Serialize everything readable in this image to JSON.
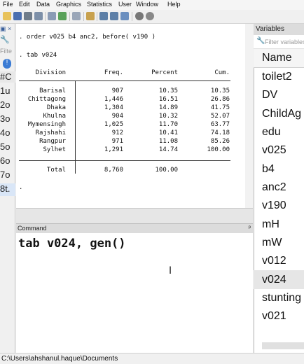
{
  "menu": [
    "File",
    "Edit",
    "Data",
    "Graphics",
    "Statistics",
    "User",
    "Window",
    "Help"
  ],
  "left_panel": {
    "filter_placeholder": "Filte",
    "col_label": "#C",
    "items": [
      "1u",
      "2o",
      "3o",
      "4o",
      "5o",
      "6o",
      "7o",
      "8t."
    ]
  },
  "results": {
    "cmd1": ". order v025 b4 anc2, before( v190 )",
    "cmd2": ". tab v024",
    "headers": {
      "division": "Division",
      "freq": "Freq.",
      "percent": "Percent",
      "cum": "Cum."
    },
    "rows": [
      {
        "division": "Barisal",
        "freq": "907",
        "percent": "10.35",
        "cum": "10.35"
      },
      {
        "division": "Chittagong",
        "freq": "1,446",
        "percent": "16.51",
        "cum": "26.86"
      },
      {
        "division": "Dhaka",
        "freq": "1,304",
        "percent": "14.89",
        "cum": "41.75"
      },
      {
        "division": "Khulna",
        "freq": "904",
        "percent": "10.32",
        "cum": "52.07"
      },
      {
        "division": "Mymensingh",
        "freq": "1,025",
        "percent": "11.70",
        "cum": "63.77"
      },
      {
        "division": "Rajshahi",
        "freq": "912",
        "percent": "10.41",
        "cum": "74.18"
      },
      {
        "division": "Rangpur",
        "freq": "971",
        "percent": "11.08",
        "cum": "85.26"
      },
      {
        "division": "Sylhet",
        "freq": "1,291",
        "percent": "14.74",
        "cum": "100.00"
      }
    ],
    "total": {
      "label": "Total",
      "freq": "8,760",
      "percent": "100.00"
    },
    "prompt": "."
  },
  "command": {
    "title": "Command",
    "text": "tab v024, gen()"
  },
  "variables": {
    "title": "Variables",
    "filter_placeholder": "Filter variables",
    "col_name": "Name",
    "items": [
      "toilet2",
      "DV",
      "ChildAg",
      "edu",
      "v025",
      "b4",
      "anc2",
      "v190",
      "mH",
      "mW",
      "v012",
      "v024",
      "stunting",
      "v021"
    ],
    "selected_index": 11
  },
  "status_bar": {
    "path": "C:\\Users\\ahshanul.haque\\Documents"
  }
}
